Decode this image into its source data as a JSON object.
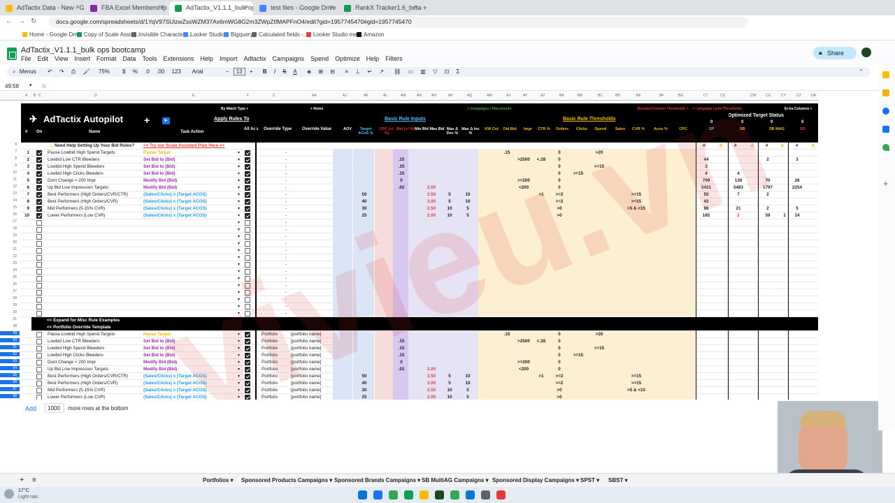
{
  "browser": {
    "tabs": [
      {
        "title": "AdTactix Data - New - Google",
        "color": "#fbbc04"
      },
      {
        "title": "FBA Excel Membership Area",
        "color": "#8e24aa"
      },
      {
        "title": "AdTactix_V1.1.1_bulk ops boot",
        "color": "#0f9d58",
        "active": true
      },
      {
        "title": "test files - Google Drive",
        "color": "#4285f4"
      },
      {
        "title": "RankX Tracker1.6_beta 11.12.2",
        "color": "#0f9d58"
      }
    ],
    "url": "docs.google.com/spreadsheets/d/1YqV97SUizwZssWZM37Ax6mWG8G2m3ZWpZtfMAPFnO4/edit?gid=1957745470#gid=1957745470",
    "bookmarks": [
      "Home - Google Drive",
      "Copy of Scale Assist...",
      "Invisible Character -...",
      "Looker Studio",
      "Bigquery",
      "Calculated fields -...",
      "Looker Studio metri...",
      "Amazon"
    ]
  },
  "doc": {
    "title": "AdTactix_V1.1.1_bulk ops bootcamp",
    "menus": [
      "File",
      "Edit",
      "View",
      "Insert",
      "Format",
      "Data",
      "Tools",
      "Extensions",
      "Help",
      "Import",
      "Adtactix",
      "Campaigns",
      "Spend",
      "Optimize",
      "Help",
      "Filters"
    ],
    "share": "Share"
  },
  "toolbar": {
    "menus": "Menus",
    "zoom": "75%",
    "font": "Arial",
    "size": "13",
    "currency": "$",
    "percent": "%",
    "dec": ".0",
    "inc": ".00",
    "num": "123"
  },
  "formula": {
    "cellref": "49:58",
    "fx": "fx"
  },
  "columns": [
    "A",
    "B",
    "C",
    "D",
    "E",
    "F",
    "Z",
    "AA",
    "AJ",
    "AK",
    "AL",
    "AM",
    "AN",
    "AO",
    "AP",
    "AQ",
    "AW",
    "AX",
    "AY",
    "AZ",
    "BA",
    "BB",
    "BC",
    "BD",
    "BE",
    "BF",
    "BG",
    "CT",
    "CU",
    "CW",
    "CX",
    "CY",
    "CZ",
    "DA"
  ],
  "header": {
    "title": "AdTactix Autopilot",
    "by_match": "By Match Type +",
    "apply_rules": "Apply Rules To",
    "hash": "#",
    "on": "On",
    "name": "Name",
    "task_action": "Task Action",
    "all_ads": "All Ads",
    "notes": "+ Notes",
    "campaigns_placements": "+ Campaigns / Placements",
    "boosted": "Boosted Column Thresholds +",
    "campaign_level": "+ Campaign Level Thresholds",
    "extra": "Extra Columns +",
    "override_type": "Override Type",
    "override_value": "Override Value",
    "basic_inputs": "Basic Rule Inputs",
    "basic_thresholds": "Basic Rule Thresholds",
    "optimized": "Optimized Target Status",
    "input_cols": [
      "AOV",
      "Target ACoS %",
      "CPC (+/-%)",
      "Bid (+/-%)",
      "Min Bid",
      "Max Bid",
      "Max Δ Dec %",
      "Max Δ Inc %",
      "KW Cnt",
      "Old Bid",
      "Impr",
      "CTR %",
      "Orders",
      "Clicks",
      "Spend",
      "Sales",
      "CVR %",
      "Acos %",
      "CPC"
    ],
    "status": [
      {
        "label": "SP",
        "v": "0"
      },
      {
        "label": "SB",
        "v": "0"
      },
      {
        "label": "SB MAG",
        "v": "0"
      },
      {
        "label": "SD",
        "v": "0"
      }
    ],
    "help": "Need Help Setting Up Your Bid Rules?",
    "help_link": ">> Try our Scale Assisted Plan Here <<"
  },
  "rules": [
    {
      "rn": "7",
      "n": "1",
      "name": "Pause Lowbid High Spend Targets",
      "act": "Pause Target",
      "ac": "#f4b400",
      "bid": "",
      "minb": "",
      "maxb": "",
      "dec": "",
      "inc": "",
      "aov": "",
      "acos": "",
      "old": ".15",
      "impr": "",
      "ctr": "",
      "ord": "0",
      "clk": "",
      "sp": ">20",
      "cvr": "",
      "s": [
        "",
        "",
        "",
        "",
        ""
      ]
    },
    {
      "rn": "8",
      "n": "2",
      "name": "Lowbid Low CTR Bleeders",
      "act": "Set Bid to (Bid)",
      "ac": "#9c27b0",
      "bid": ".15",
      "minb": "",
      "maxb": "",
      "dec": "",
      "inc": "",
      "aov": "",
      "acos": "",
      "old": "",
      "impr": ">2500",
      "ctr": "<.28",
      "ord": "0",
      "clk": "",
      "sp": "",
      "cvr": "",
      "s": [
        "44",
        "",
        "2",
        "",
        "3"
      ]
    },
    {
      "rn": "9",
      "n": "3",
      "name": "Lowbid High Spend Bleeders",
      "act": "Set Bid to (Bid)",
      "ac": "#9c27b0",
      "bid": ".15",
      "minb": "",
      "maxb": "",
      "dec": "",
      "inc": "",
      "aov": "",
      "acos": "",
      "old": "",
      "impr": "",
      "ctr": "",
      "ord": "0",
      "clk": "",
      "sp": ">=15",
      "cvr": "",
      "s": [
        "3",
        "",
        "",
        "",
        ""
      ]
    },
    {
      "rn": "10",
      "n": "4",
      "name": "Lowbid High Clicks Bleeders",
      "act": "Set Bid to (Bid)",
      "ac": "#9c27b0",
      "bid": ".15",
      "minb": "",
      "maxb": "",
      "dec": "",
      "inc": "",
      "aov": "",
      "acos": "",
      "old": "",
      "impr": "",
      "ctr": "",
      "ord": "0",
      "clk": ">=15",
      "sp": "",
      "cvr": "",
      "s": [
        "4",
        "4",
        "",
        "",
        ""
      ]
    },
    {
      "rn": "11",
      "n": "5",
      "name": "Dont Change > 200 Impr",
      "act": "Modify Bid (Bid)",
      "ac": "#9c27b0",
      "bid": "0",
      "minb": "",
      "maxb": "",
      "dec": "",
      "inc": "",
      "aov": "",
      "acos": "",
      "old": "",
      "impr": ">=200",
      "ctr": "",
      "ord": "0",
      "clk": "",
      "sp": "",
      "cvr": "",
      "s": [
        "709",
        "138",
        "70",
        "",
        "26"
      ]
    },
    {
      "rn": "12",
      "n": "6",
      "name": "Up Bid Low Impression Targets",
      "act": "Modify Bid (Bid)",
      "ac": "#9c27b0",
      "bid": ".02",
      "minb": "",
      "maxb": "2.00",
      "dec": "",
      "inc": "",
      "aov": "",
      "acos": "",
      "old": "",
      "impr": "<200",
      "ctr": "",
      "ord": "0",
      "clk": "",
      "sp": "",
      "cvr": "",
      "s": [
        "5431",
        "5483",
        "1797",
        "",
        "2254"
      ]
    },
    {
      "rn": "13",
      "n": "7",
      "name": "Best Performers (High Orders/CVR/CTR)",
      "act": "(Sales/Clicks) x (Target ACOS)",
      "ac": "#1e9be8",
      "bid": "",
      "minb": "",
      "maxb": "3.50",
      "dec": "5",
      "inc": "10",
      "aov": "",
      "acos": "50",
      "old": "",
      "impr": "",
      "ctr": ">1",
      "ord": ">=2",
      "clk": "",
      "sp": "",
      "cvr": ">=15",
      "s": [
        "55",
        "7",
        "2",
        "",
        ""
      ]
    },
    {
      "rn": "14",
      "n": "8",
      "name": "Best Performers (High Orders/CVR)",
      "act": "(Sales/Clicks) x (Target ACOS)",
      "ac": "#1e9be8",
      "bid": "",
      "minb": "",
      "maxb": "3.00",
      "dec": "5",
      "inc": "10",
      "aov": "",
      "acos": "40",
      "old": "",
      "impr": "",
      "ctr": "",
      "ord": ">=2",
      "clk": "",
      "sp": "",
      "cvr": ">=15",
      "s": [
        "42",
        "",
        "",
        "",
        ""
      ]
    },
    {
      "rn": "15",
      "n": "9",
      "name": "Mid Performers (5-15% CVR)",
      "act": "(Sales/Clicks) x (Target ACOS)",
      "ac": "#1e9be8",
      "bid": "",
      "minb": "",
      "maxb": "2.50",
      "dec": "10",
      "inc": "5",
      "aov": "",
      "acos": "30",
      "old": "",
      "impr": "",
      "ctr": "",
      "ord": ">0",
      "clk": "",
      "sp": "",
      "cvr": ">5 & <15",
      "s": [
        "96",
        "21",
        "2",
        "",
        "5"
      ]
    },
    {
      "rn": "16",
      "n": "10",
      "name": "Lower Performers (Low CVR)",
      "act": "(Sales/Clicks) x (Target ACOS)",
      "ac": "#1e9be8",
      "bid": "",
      "minb": "",
      "maxb": "2.00",
      "dec": "10",
      "inc": "5",
      "aov": "",
      "acos": "25",
      "old": "",
      "impr": "",
      "ctr": "",
      "ord": ">0",
      "clk": "",
      "sp": "",
      "cvr": "",
      "s": [
        "165",
        "2",
        "59",
        "1",
        "14"
      ]
    }
  ],
  "empty_rows": [
    "17",
    "18",
    "19",
    "20",
    "21",
    "22",
    "23",
    "24",
    "25",
    "26",
    "27",
    "28",
    "29",
    "30"
  ],
  "expand1": "<< Expand for Misc Rule Examples",
  "expand2": "<< Portfolio Override Template",
  "portfolio": {
    "type": "Portfolio",
    "value": "[portfolio name]",
    "rows": [
      "49",
      "50",
      "51",
      "52",
      "53",
      "54",
      "55",
      "56",
      "57",
      "58"
    ]
  },
  "add_rows": {
    "label": "Add",
    "count": "1000",
    "suffix": "more rows at the bottom"
  },
  "sheet_tabs": [
    "Portfolios",
    "Sponsored Products Campaigns",
    "Sponsored Brands Campaigns",
    "SB MultiAG Campaigns",
    "Sponsored Display Campaigns",
    "SPST",
    "SBST"
  ],
  "weather": {
    "temp": "17°C",
    "desc": "Light rain"
  },
  "watermark": "vivieu.vn"
}
